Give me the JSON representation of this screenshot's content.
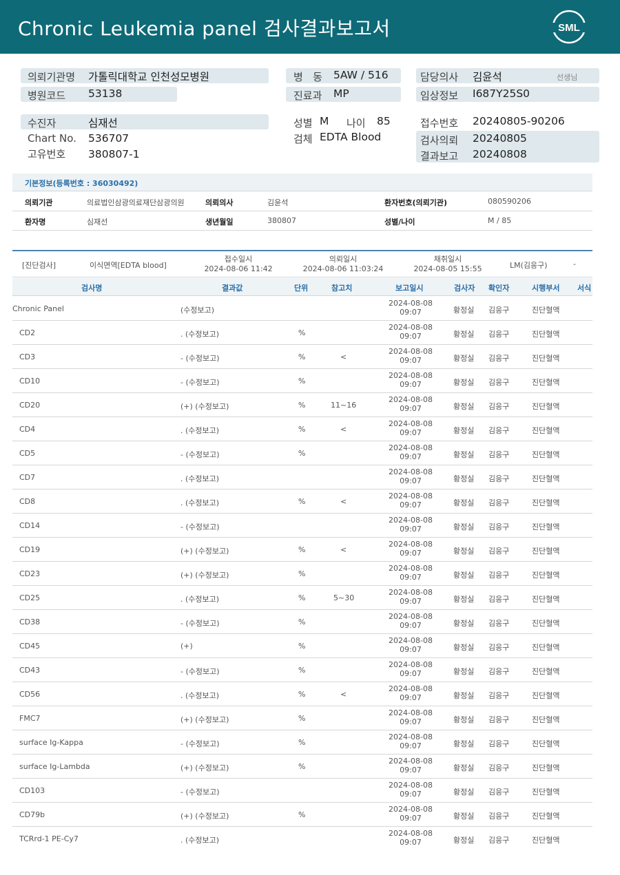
{
  "header": {
    "title": "Chronic  Leukemia  panel 검사결과보고서",
    "logo_text": "SML",
    "color": "#0e6a77"
  },
  "patient": {
    "institution_label": "의뢰기관명",
    "institution": "가톨릭대학교 인천성모병원",
    "hospital_code_label": "병원코드",
    "hospital_code": "53138",
    "ward_label": "병   동",
    "ward": "5AW / 516",
    "dept_label": "진료과",
    "dept": "MP",
    "doctor_label": "담당의사",
    "doctor": "김윤석",
    "doctor_suffix": "선생님",
    "clinical_label": "임상정보",
    "clinical": "I687Y25S0",
    "examinee_label": "수진자",
    "examinee": "심재선",
    "chart_label": "Chart No.",
    "chart": "536707",
    "unique_label": "고유번호",
    "unique": "380807-1",
    "sex_label": "성별",
    "sex": "M",
    "age_label": "나이",
    "age": "85",
    "specimen_label": "검체",
    "specimen": "EDTA Blood",
    "receipt_label": "접수번호",
    "receipt": "20240805-90206",
    "request_label": "검사의뢰",
    "request": "20240805",
    "report_label": "결과보고",
    "report": "20240808"
  },
  "basic_info": {
    "title": "기본정보(등록번호 : 36030492)",
    "row1": {
      "k1": "의뢰기관",
      "v1": "의료법인삼광의료재단삼광의원",
      "k2": "의뢰의사",
      "v2": "김윤석",
      "k3": "환자번호(의뢰기관)",
      "v3": "080590206"
    },
    "row2": {
      "k1": "환자명",
      "v1": "심재선",
      "k2": "생년월일",
      "v2": "380807",
      "k3": "성별/나이",
      "v3": "M / 85"
    }
  },
  "diagnosis": {
    "category": "[진단검사]",
    "test": "이식면역[EDTA blood]",
    "receipt_label": "접수일시",
    "receipt_time": "2024-08-06 11:42",
    "request_label": "의뢰일시",
    "request_time": "2024-08-06 11:03:24",
    "collect_label": "채취일시",
    "collect_time": "2024-08-05 15:55",
    "lm": "LM(김응구)",
    "dash": "-"
  },
  "table": {
    "headers": [
      "검사명",
      "결과값",
      "단위",
      "참고치",
      "보고일시",
      "검사자",
      "확인자",
      "시행부서",
      "서식"
    ],
    "rows": [
      {
        "name": "Chronic Panel",
        "result": "(수정보고)",
        "unit": "",
        "ref": "",
        "date": "2024-08-08",
        "time": "09:07",
        "tester": "황정실",
        "checker": "김응구",
        "dept": "진단혈액"
      },
      {
        "name": "CD2",
        "result": ". (수정보고)",
        "unit": "%",
        "ref": "",
        "date": "2024-08-08",
        "time": "09:07",
        "tester": "황정실",
        "checker": "김응구",
        "dept": "진단혈액"
      },
      {
        "name": "CD3",
        "result": "- (수정보고)",
        "unit": "%",
        "ref": "<",
        "date": "2024-08-08",
        "time": "09:07",
        "tester": "황정실",
        "checker": "김응구",
        "dept": "진단혈액"
      },
      {
        "name": "CD10",
        "result": "- (수정보고)",
        "unit": "%",
        "ref": "",
        "date": "2024-08-08",
        "time": "09:07",
        "tester": "황정실",
        "checker": "김응구",
        "dept": "진단혈액"
      },
      {
        "name": "CD20",
        "result": "(+) (수정보고)",
        "unit": "%",
        "ref": "11~16",
        "date": "2024-08-08",
        "time": "09:07",
        "tester": "황정실",
        "checker": "김응구",
        "dept": "진단혈액"
      },
      {
        "name": "CD4",
        "result": ". (수정보고)",
        "unit": "%",
        "ref": "<",
        "date": "2024-08-08",
        "time": "09:07",
        "tester": "황정실",
        "checker": "김응구",
        "dept": "진단혈액"
      },
      {
        "name": "CD5",
        "result": "- (수정보고)",
        "unit": "%",
        "ref": "",
        "date": "2024-08-08",
        "time": "09:07",
        "tester": "황정실",
        "checker": "김응구",
        "dept": "진단혈액"
      },
      {
        "name": "CD7",
        "result": ". (수정보고)",
        "unit": "",
        "ref": "",
        "date": "2024-08-08",
        "time": "09:07",
        "tester": "황정실",
        "checker": "김응구",
        "dept": "진단혈액"
      },
      {
        "name": "CD8",
        "result": ". (수정보고)",
        "unit": "%",
        "ref": "<",
        "date": "2024-08-08",
        "time": "09:07",
        "tester": "황정실",
        "checker": "김응구",
        "dept": "진단혈액"
      },
      {
        "name": "CD14",
        "result": "- (수정보고)",
        "unit": "",
        "ref": "",
        "date": "2024-08-08",
        "time": "09:07",
        "tester": "황정실",
        "checker": "김응구",
        "dept": "진단혈액"
      },
      {
        "name": "CD19",
        "result": "(+) (수정보고)",
        "unit": "%",
        "ref": "<",
        "date": "2024-08-08",
        "time": "09:07",
        "tester": "황정실",
        "checker": "김응구",
        "dept": "진단혈액"
      },
      {
        "name": "CD23",
        "result": "(+) (수정보고)",
        "unit": "%",
        "ref": "",
        "date": "2024-08-08",
        "time": "09:07",
        "tester": "황정실",
        "checker": "김응구",
        "dept": "진단혈액"
      },
      {
        "name": "CD25",
        "result": ". (수정보고)",
        "unit": "%",
        "ref": "5~30",
        "date": "2024-08-08",
        "time": "09:07",
        "tester": "황정실",
        "checker": "김응구",
        "dept": "진단혈액"
      },
      {
        "name": "CD38",
        "result": "- (수정보고)",
        "unit": "%",
        "ref": "",
        "date": "2024-08-08",
        "time": "09:07",
        "tester": "황정실",
        "checker": "김응구",
        "dept": "진단혈액"
      },
      {
        "name": "CD45",
        "result": "(+)",
        "unit": "%",
        "ref": "",
        "date": "2024-08-08",
        "time": "09:07",
        "tester": "황정실",
        "checker": "김응구",
        "dept": "진단혈액"
      },
      {
        "name": "CD43",
        "result": "- (수정보고)",
        "unit": "%",
        "ref": "",
        "date": "2024-08-08",
        "time": "09:07",
        "tester": "황정실",
        "checker": "김응구",
        "dept": "진단혈액"
      },
      {
        "name": "CD56",
        "result": ". (수정보고)",
        "unit": "%",
        "ref": "<",
        "date": "2024-08-08",
        "time": "09:07",
        "tester": "황정실",
        "checker": "김응구",
        "dept": "진단혈액"
      },
      {
        "name": "FMC7",
        "result": "(+) (수정보고)",
        "unit": "%",
        "ref": "",
        "date": "2024-08-08",
        "time": "09:07",
        "tester": "황정실",
        "checker": "김응구",
        "dept": "진단혈액"
      },
      {
        "name": "surface Ig-Kappa",
        "result": "- (수정보고)",
        "unit": "%",
        "ref": "",
        "date": "2024-08-08",
        "time": "09:07",
        "tester": "황정실",
        "checker": "김응구",
        "dept": "진단혈액"
      },
      {
        "name": "surface Ig-Lambda",
        "result": "(+) (수정보고)",
        "unit": "%",
        "ref": "",
        "date": "2024-08-08",
        "time": "09:07",
        "tester": "황정실",
        "checker": "김응구",
        "dept": "진단혈액"
      },
      {
        "name": "CD103",
        "result": "- (수정보고)",
        "unit": "",
        "ref": "",
        "date": "2024-08-08",
        "time": "09:07",
        "tester": "황정실",
        "checker": "김응구",
        "dept": "진단혈액"
      },
      {
        "name": "CD79b",
        "result": "(+) (수정보고)",
        "unit": "%",
        "ref": "",
        "date": "2024-08-08",
        "time": "09:07",
        "tester": "황정실",
        "checker": "김응구",
        "dept": "진단혈액"
      },
      {
        "name": "TCRrd-1 PE-Cy7",
        "result": ". (수정보고)",
        "unit": "",
        "ref": "",
        "date": "2024-08-08",
        "time": "09:07",
        "tester": "황정실",
        "checker": "김응구",
        "dept": "진단혈액"
      }
    ]
  }
}
